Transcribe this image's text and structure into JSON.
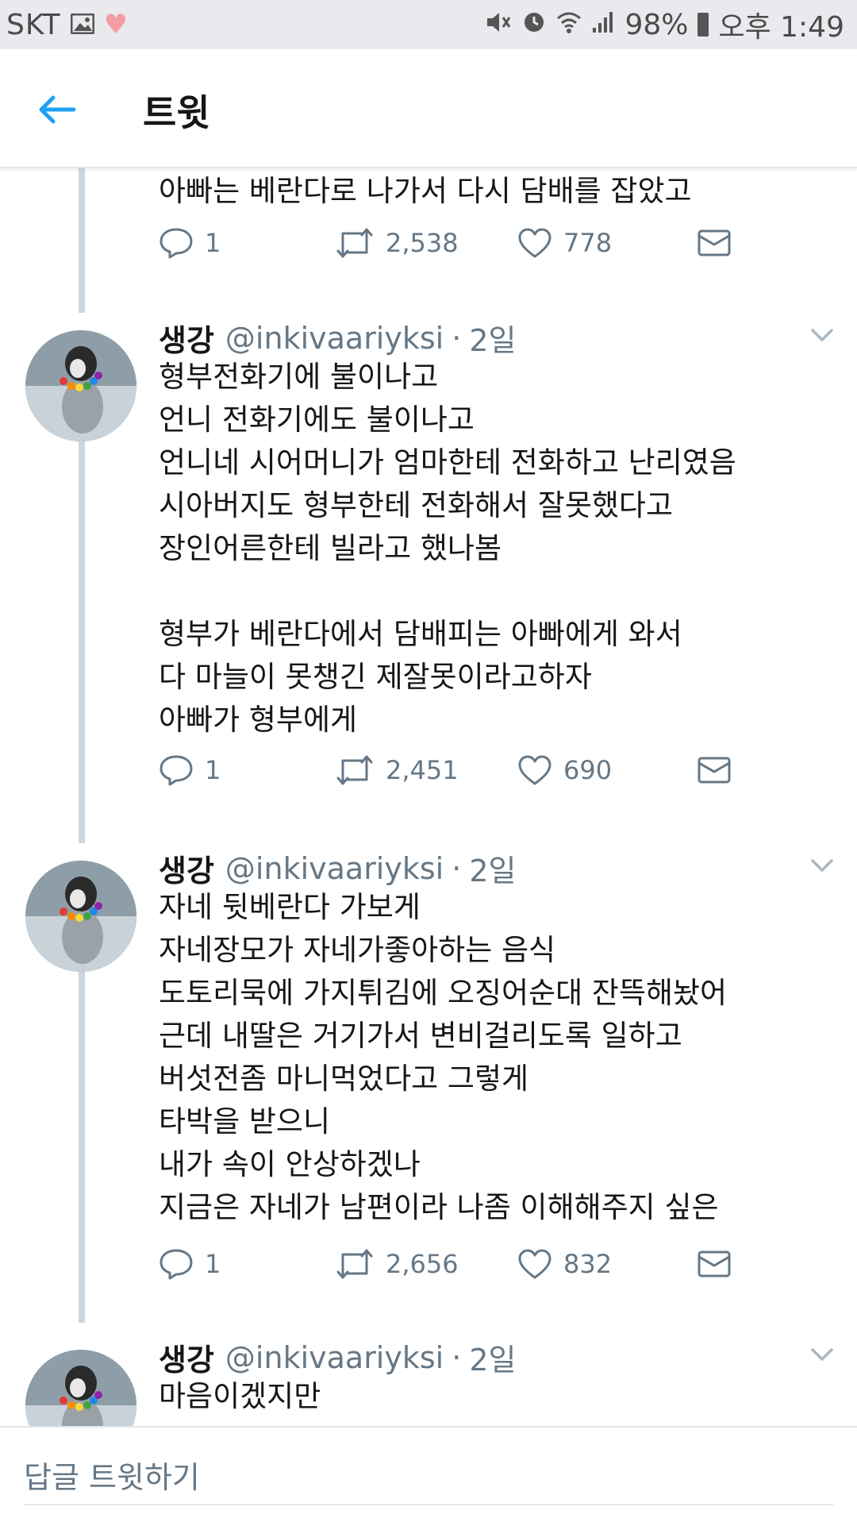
{
  "status_bar": {
    "carrier": "SKT",
    "battery": "98%",
    "time": "오후 1:49",
    "icons": [
      "image-icon",
      "heart-icon",
      "mute-icon",
      "alarm-icon",
      "wifi-icon",
      "signal-icon",
      "battery-icon"
    ]
  },
  "header": {
    "title": "트윗",
    "back_icon": "arrow-left-icon"
  },
  "partial_tweet": {
    "text_lines": [
      "아빠는  베란다로 나가서 다시 담배를 잡았고"
    ],
    "replies": "1",
    "retweets": "2,538",
    "likes": "778"
  },
  "tweets": [
    {
      "name": "생강",
      "handle": "@inkivaariyksi",
      "time": "2일",
      "text_lines": [
        "형부전화기에 불이나고",
        "언니 전화기에도 불이나고",
        "언니네 시어머니가 엄마한테 전화하고 난리였음",
        "시아버지도 형부한테 전화해서  잘못했다고",
        "장인어른한테 빌라고 했나봄",
        "",
        "형부가 베란다에서 담배피는 아빠에게 와서",
        "다 마늘이 못챙긴 제잘못이라고하자",
        "아빠가 형부에게"
      ],
      "replies": "1",
      "retweets": "2,451",
      "likes": "690"
    },
    {
      "name": "생강",
      "handle": "@inkivaariyksi",
      "time": "2일",
      "text_lines": [
        "자네 뒷베란다 가보게",
        "자네장모가 자네가좋아하는 음식",
        "도토리묵에 가지튀김에  오징어순대 잔뜩해놨어",
        "근데 내딸은 거기가서 변비걸리도록 일하고",
        "버섯전좀 마니먹었다고 그렇게",
        "타박을 받으니",
        "내가 속이 안상하겠나",
        "지금은 자네가 남편이라  나좀 이해해주지 싶은"
      ],
      "replies": "1",
      "retweets": "2,656",
      "likes": "832"
    },
    {
      "name": "생강",
      "handle": "@inkivaariyksi",
      "time": "2일",
      "text_lines": [
        "마음이겠지만"
      ]
    }
  ],
  "reply_bar": {
    "placeholder": "답글 트윗하기"
  },
  "colors": {
    "accent": "#1da1f2",
    "secondary_text": "#657786",
    "thread_line": "#cdd6de",
    "status_bar": "#e8eaed"
  }
}
